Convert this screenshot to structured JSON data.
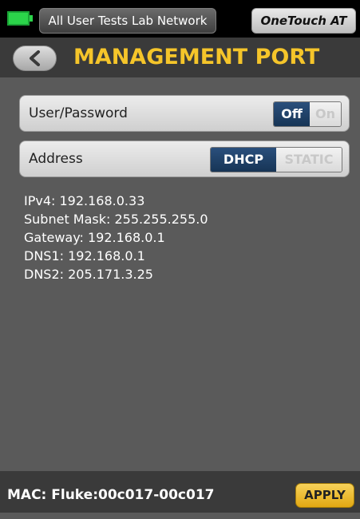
{
  "status_bar": {
    "battery_icon": "battery-icon",
    "battery_color": "#2bd44a",
    "profile_label": "All User Tests Lab Network",
    "device_label": "OneTouch AT"
  },
  "header": {
    "back_icon": "chevron-left-icon",
    "title": "MANAGEMENT PORT"
  },
  "settings": {
    "user_password": {
      "label": "User/Password",
      "options": [
        "Off",
        "On"
      ],
      "selected": "Off"
    },
    "address": {
      "label": "Address",
      "options": [
        "DHCP",
        "STATIC"
      ],
      "selected": "DHCP"
    }
  },
  "network_details": {
    "ipv4": "IPv4: 192.168.0.33",
    "subnet_mask": "Subnet Mask: 255.255.255.0",
    "gateway": "Gateway: 192.168.0.1",
    "dns1": "DNS1: 192.168.0.1",
    "dns2": "DNS2: 205.171.3.25"
  },
  "footer": {
    "mac": "MAC: Fluke:00c017-00c017",
    "apply_label": "APPLY"
  },
  "colors": {
    "accent_title": "#f5c52a",
    "selected_segment": "#1f4268",
    "apply_button": "#f0bd2e",
    "background": "#5a5a5a"
  }
}
